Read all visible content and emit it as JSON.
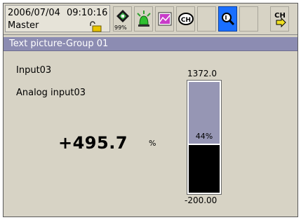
{
  "status": {
    "date": "2006/07/04",
    "time": "09:10:16",
    "user": "Master",
    "memory_percent": "99%"
  },
  "toolbar": {
    "icons": [
      "memory-icon",
      "alarm-icon",
      "display-icon",
      "channel-icon",
      "blank-button",
      "search-icon",
      "blank-button",
      "channel-switch-icon"
    ],
    "active_color": "#1a6fff",
    "channel_label": "CH",
    "switch_label": "CH"
  },
  "title": {
    "text": "Text picture-Group 01",
    "bg_color": "#8c8cb2"
  },
  "channel": {
    "tag": "Input03",
    "comment": "Analog input03",
    "value": "+495.7",
    "unit": "%"
  },
  "bargraph": {
    "max_label": "1372.0",
    "min_label": "-200.00",
    "percent_label": "44%",
    "fill_fraction": 0.44,
    "bar_color": "#9696b4",
    "fill_color": "#000000"
  }
}
